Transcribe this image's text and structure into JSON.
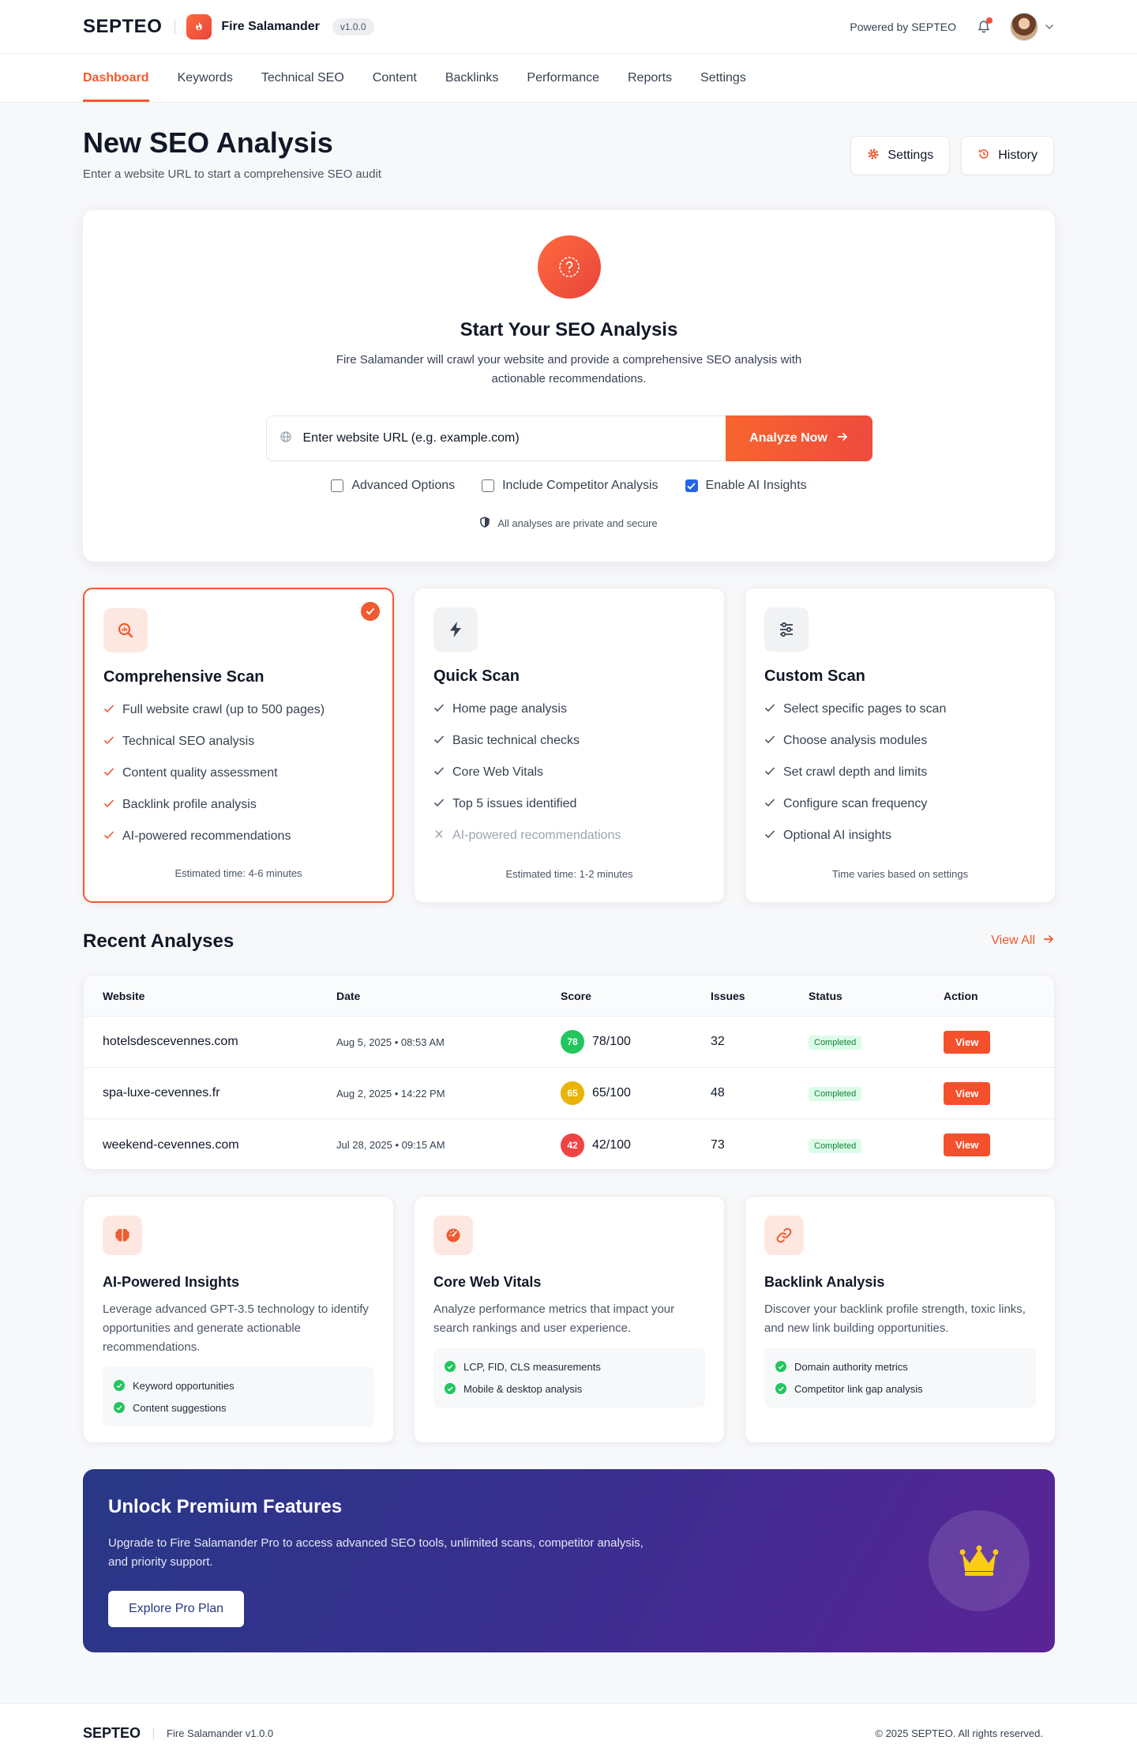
{
  "header": {
    "brand": "SEPTEO",
    "app_name": "Fire Salamander",
    "version": "v1.0.0",
    "powered_by": "Powered by SEPTEO",
    "icons": {
      "logo": "flame-icon",
      "notifications": "bell-icon",
      "avatar": "user-avatar",
      "menu": "chevron-down-icon"
    }
  },
  "nav": {
    "items": [
      {
        "label": "Dashboard"
      },
      {
        "label": "Keywords"
      },
      {
        "label": "Technical SEO"
      },
      {
        "label": "Content"
      },
      {
        "label": "Backlinks"
      },
      {
        "label": "Performance"
      },
      {
        "label": "Reports"
      },
      {
        "label": "Settings"
      }
    ],
    "active": "Dashboard"
  },
  "page": {
    "title": "New SEO Analysis",
    "subtitle": "Enter a website URL to start a comprehensive SEO audit",
    "settings_label": "Settings",
    "history_label": "History"
  },
  "start": {
    "title": "Start Your SEO Analysis",
    "description": "Fire Salamander will crawl your website and provide a comprehensive SEO analysis with actionable recommendations.",
    "url_placeholder": "Enter website URL (e.g. example.com)",
    "analyze_label": "Analyze Now",
    "options": [
      {
        "label": "Advanced Options",
        "checked": false
      },
      {
        "label": "Include Competitor Analysis",
        "checked": false
      },
      {
        "label": "Enable AI Insights",
        "checked": true
      }
    ],
    "secure_note": "All analyses are private and secure"
  },
  "scan_types": [
    {
      "title": "Comprehensive Scan",
      "selected": true,
      "icon": "search-chart-icon",
      "items": [
        {
          "label": "Full website crawl (up to 500 pages)",
          "included": true
        },
        {
          "label": "Technical SEO analysis",
          "included": true
        },
        {
          "label": "Content quality assessment",
          "included": true
        },
        {
          "label": "Backlink profile analysis",
          "included": true
        },
        {
          "label": "AI-powered recommendations",
          "included": true
        }
      ],
      "footer": "Estimated time: 4-6 minutes"
    },
    {
      "title": "Quick Scan",
      "selected": false,
      "icon": "lightning-icon",
      "items": [
        {
          "label": "Home page analysis",
          "included": true
        },
        {
          "label": "Basic technical checks",
          "included": true
        },
        {
          "label": "Core Web Vitals",
          "included": true
        },
        {
          "label": "Top 5 issues identified",
          "included": true
        },
        {
          "label": "AI-powered recommendations",
          "included": false
        }
      ],
      "footer": "Estimated time: 1-2 minutes"
    },
    {
      "title": "Custom Scan",
      "selected": false,
      "icon": "sliders-icon",
      "items": [
        {
          "label": "Select specific pages to scan",
          "included": true
        },
        {
          "label": "Choose analysis modules",
          "included": true
        },
        {
          "label": "Set crawl depth and limits",
          "included": true
        },
        {
          "label": "Configure scan frequency",
          "included": true
        },
        {
          "label": "Optional AI insights",
          "included": true
        }
      ],
      "footer": "Time varies based on settings"
    }
  ],
  "recent": {
    "title": "Recent Analyses",
    "view_all": "View All",
    "columns": [
      "Website",
      "Date",
      "Score",
      "Issues",
      "Status",
      "Action"
    ],
    "rows": [
      {
        "website": "hotelsdescevennes.com",
        "date": "Aug 5, 2025 • 08:53 AM",
        "score": "78",
        "score_text": "78/100",
        "score_color": "#22c55e",
        "issues": "32",
        "status": "Completed",
        "action": "View"
      },
      {
        "website": "spa-luxe-cevennes.fr",
        "date": "Aug 2, 2025 • 14:22 PM",
        "score": "65",
        "score_text": "65/100",
        "score_color": "#eab308",
        "issues": "48",
        "status": "Completed",
        "action": "View"
      },
      {
        "website": "weekend-cevennes.com",
        "date": "Jul 28, 2025 • 09:15 AM",
        "score": "42",
        "score_text": "42/100",
        "score_color": "#ef4444",
        "issues": "73",
        "status": "Completed",
        "action": "View"
      }
    ]
  },
  "features": [
    {
      "title": "AI-Powered Insights",
      "icon": "brain-icon",
      "description": "Leverage advanced GPT-3.5 technology to identify opportunities and generate actionable recommendations.",
      "bullets": [
        "Keyword opportunities",
        "Content suggestions"
      ]
    },
    {
      "title": "Core Web Vitals",
      "icon": "gauge-icon",
      "description": "Analyze performance metrics that impact your search rankings and user experience.",
      "bullets": [
        "LCP, FID, CLS measurements",
        "Mobile & desktop analysis"
      ]
    },
    {
      "title": "Backlink Analysis",
      "icon": "link-icon",
      "description": "Discover your backlink profile strength, toxic links, and new link building opportunities.",
      "bullets": [
        "Domain authority metrics",
        "Competitor link gap analysis"
      ]
    }
  ],
  "premium": {
    "title": "Unlock Premium Features",
    "description": "Upgrade to Fire Salamander Pro to access advanced SEO tools, unlimited scans, competitor analysis, and priority support.",
    "button": "Explore Pro Plan",
    "icon": "crown-icon"
  },
  "footer": {
    "brand": "SEPTEO",
    "app": "Fire Salamander v1.0.0",
    "copyright": "© 2025 SEPTEO. All rights reserved."
  },
  "colors": {
    "accent": "#f05a30",
    "premium_start": "#283886",
    "premium_end": "#5b2497",
    "success": "#22c55e"
  }
}
